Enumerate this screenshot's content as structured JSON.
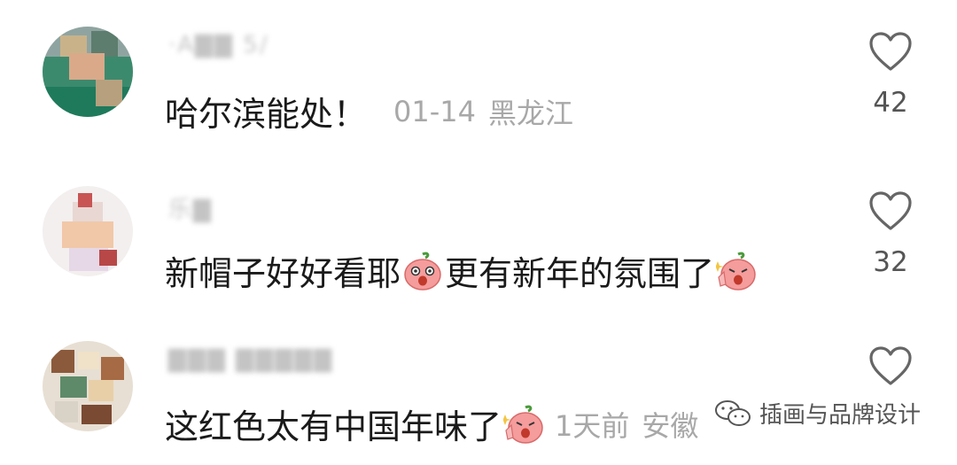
{
  "colors": {
    "text": "#1a1a1a",
    "meta": "#a8a8a8",
    "icon": "#666666",
    "emoji_face": "#f59c9c"
  },
  "comments": [
    {
      "username": "·A▇▇ 5∕",
      "text": "哈尔滨能处！",
      "date": "01-14",
      "location": "黑龙江",
      "likes": "42"
    },
    {
      "username": "乐▇",
      "text_parts": [
        "新帽子好好看耶",
        "更有新年的氛围了"
      ],
      "likes": "32"
    },
    {
      "username": "▇▇▇ ▇▇▇▇▇",
      "text": "这红色太有中国年味了",
      "date": "1天前",
      "location": "安徽"
    }
  ],
  "watermark": {
    "text": "插画与品牌设计",
    "icon": "wechat-icon"
  }
}
